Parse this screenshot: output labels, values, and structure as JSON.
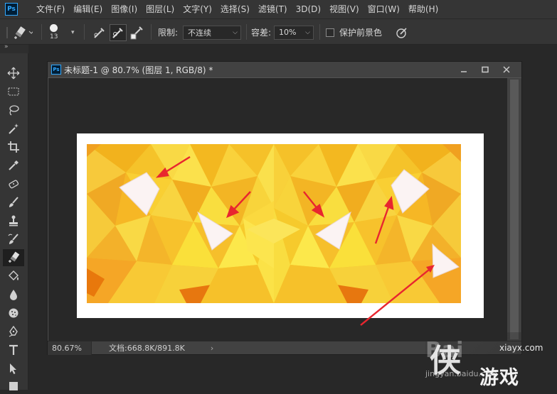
{
  "app": {
    "logo_text": "Ps"
  },
  "menu": {
    "items": [
      "文件(F)",
      "编辑(E)",
      "图像(I)",
      "图层(L)",
      "文字(Y)",
      "选择(S)",
      "滤镜(T)",
      "3D(D)",
      "视图(V)",
      "窗口(W)",
      "帮助(H)"
    ]
  },
  "options": {
    "brush_size": "13",
    "limit_label": "限制:",
    "limit_value": "不连续",
    "tolerance_label": "容差:",
    "tolerance_value": "10%",
    "protect_fg_label": "保护前景色",
    "protect_fg_checked": false
  },
  "tools": [
    {
      "name": "move-tool-icon"
    },
    {
      "name": "marquee-tool-icon"
    },
    {
      "name": "lasso-tool-icon"
    },
    {
      "name": "magic-wand-tool-icon"
    },
    {
      "name": "crop-tool-icon"
    },
    {
      "name": "eyedropper-tool-icon"
    },
    {
      "name": "healing-brush-tool-icon"
    },
    {
      "name": "brush-tool-icon"
    },
    {
      "name": "clone-stamp-tool-icon"
    },
    {
      "name": "history-brush-tool-icon"
    },
    {
      "name": "background-eraser-tool-icon",
      "active": true
    },
    {
      "name": "paint-bucket-tool-icon"
    },
    {
      "name": "blur-tool-icon"
    },
    {
      "name": "sponge-tool-icon"
    },
    {
      "name": "pen-tool-icon"
    },
    {
      "name": "type-tool-icon"
    },
    {
      "name": "path-selection-tool-icon"
    },
    {
      "name": "rectangle-tool-icon"
    }
  ],
  "document": {
    "title": "未标题-1 @ 80.7% (图层 1, RGB/8) *",
    "zoom": "80.67%",
    "doc_size": "文档:668.8K/891.8K"
  },
  "watermark": {
    "logo": "侠",
    "url": "xiayx.com",
    "brand": "游戏",
    "ghost": "Bai",
    "sub": "jingyan.baidu.com"
  },
  "colors": {
    "accent": "#31a8ff",
    "arrow": "#e8262f"
  }
}
